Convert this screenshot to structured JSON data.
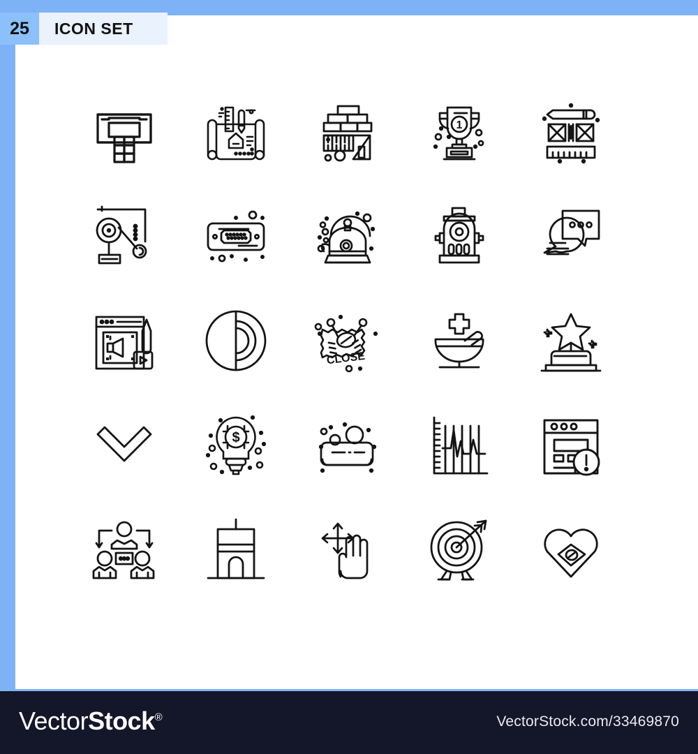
{
  "header": {
    "count": "25",
    "title": "ICON SET"
  },
  "footer": {
    "brand_light": "Vector",
    "brand_bold": "Stock",
    "brand_registered": "®",
    "url": "VectorStock.com/33469870"
  },
  "colors": {
    "border_blue": "#7db2f7",
    "badge_blue": "#8cc0fa",
    "title_plate": "#e9f2fd",
    "canvas": "#ffffff",
    "footer_dark": "#141729",
    "icon_stroke": "#141414"
  },
  "grid": {
    "columns": 5,
    "rows": 5,
    "total": 25
  },
  "icons": [
    {
      "row": 1,
      "col": 1,
      "name": "atm-machine-icon",
      "label": "ATM Machine"
    },
    {
      "row": 1,
      "col": 2,
      "name": "blueprint-house-icon",
      "label": "House Blueprint"
    },
    {
      "row": 1,
      "col": 3,
      "name": "brick-wall-ruler-icon",
      "label": "Brick Wall and Ruler"
    },
    {
      "row": 1,
      "col": 4,
      "name": "trophy-first-place-icon",
      "label": "First Place Trophy"
    },
    {
      "row": 1,
      "col": 5,
      "name": "pencil-ruler-wireframe-icon",
      "label": "Drafting Tools"
    },
    {
      "row": 2,
      "col": 1,
      "name": "pulley-crane-icon",
      "label": "Pulley"
    },
    {
      "row": 2,
      "col": 2,
      "name": "vga-port-icon",
      "label": "VGA Port"
    },
    {
      "row": 2,
      "col": 3,
      "name": "kettle-steam-icon",
      "label": "Kettle"
    },
    {
      "row": 2,
      "col": 4,
      "name": "fire-hydrant-icon",
      "label": "Fire Hydrant"
    },
    {
      "row": 2,
      "col": 5,
      "name": "chat-bubbles-icon",
      "label": "Chat Bubbles"
    },
    {
      "row": 3,
      "col": 1,
      "name": "video-editing-window-icon",
      "label": "Video Editing"
    },
    {
      "row": 3,
      "col": 2,
      "name": "contrast-circle-icon",
      "label": "Contrast"
    },
    {
      "row": 3,
      "col": 3,
      "name": "close-sign-icon",
      "label": "Close Sign",
      "text": "CLOSE"
    },
    {
      "row": 3,
      "col": 4,
      "name": "mortar-pestle-icon",
      "label": "Mortar and Pestle"
    },
    {
      "row": 3,
      "col": 5,
      "name": "star-award-icon",
      "label": "Star Award"
    },
    {
      "row": 4,
      "col": 1,
      "name": "chevron-down-icon",
      "label": "Chevron Down"
    },
    {
      "row": 4,
      "col": 2,
      "name": "idea-money-bulb-icon",
      "label": "Money Idea"
    },
    {
      "row": 4,
      "col": 3,
      "name": "soap-bubbles-icon",
      "label": "Soap"
    },
    {
      "row": 4,
      "col": 4,
      "name": "seismograph-chart-icon",
      "label": "Seismograph"
    },
    {
      "row": 4,
      "col": 5,
      "name": "browser-error-icon",
      "label": "Browser Error"
    },
    {
      "row": 5,
      "col": 1,
      "name": "team-hierarchy-icon",
      "label": "Team Hierarchy"
    },
    {
      "row": 5,
      "col": 2,
      "name": "tower-building-icon",
      "label": "Tower Building"
    },
    {
      "row": 5,
      "col": 3,
      "name": "drag-hand-gesture-icon",
      "label": "Drag Gesture"
    },
    {
      "row": 5,
      "col": 4,
      "name": "target-arrow-icon",
      "label": "Target with Arrow"
    },
    {
      "row": 5,
      "col": 5,
      "name": "heart-eye-icon",
      "label": "Heart with Eye"
    }
  ]
}
